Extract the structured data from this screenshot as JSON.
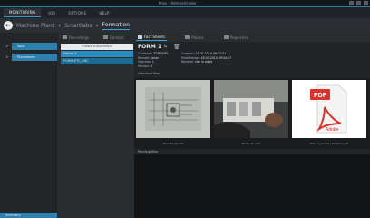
{
  "window": {
    "title": "Maxi - Administrador"
  },
  "menu": {
    "items": [
      {
        "label": "MONITORING",
        "active": true
      },
      {
        "label": "JOB",
        "active": false
      },
      {
        "label": "OPTIONS",
        "active": false
      },
      {
        "label": "HELP",
        "active": false
      }
    ]
  },
  "breadcrumb": {
    "items": [
      "Machine Plant",
      "Smartlabs",
      "Formation"
    ]
  },
  "sidebar": {
    "items": [
      {
        "label": "Tools"
      },
      {
        "label": "Procedures"
      }
    ],
    "bottom_label": "Inventory"
  },
  "midpanel": {
    "search_placeholder": "Create a document",
    "rows": [
      {
        "label": "Forme 1",
        "selected": true
      },
      {
        "label": "FORM_ETC_ARC",
        "selected": false
      }
    ]
  },
  "top_tabs": {
    "items": [
      "Recordings",
      "Contact"
    ]
  },
  "detail_tabs": {
    "items": [
      {
        "label": "Fact Sheets",
        "active": true
      },
      {
        "label": "Photos",
        "active": false
      },
      {
        "label": "Properties",
        "active": false
      }
    ]
  },
  "detail": {
    "title": "FORM 1",
    "meta_left": [
      {
        "k": "Customer:",
        "v": "TORNADE"
      },
      {
        "k": "Remote:",
        "v": "Johan"
      },
      {
        "k": "Operator:",
        "v": "L"
      },
      {
        "k": "Version:",
        "v": "4"
      }
    ],
    "meta_right": [
      {
        "k": "Creation:",
        "v": "21.02.2014 09:12:01"
      },
      {
        "k": "Modification:",
        "v": "16.03.2014 09:04:17"
      },
      {
        "k": "Revision:",
        "v": "Not in stock"
      }
    ],
    "files_label": "Attached files",
    "lower_label": "Pending files",
    "thumbs": [
      {
        "caption": "Nice Blueprints",
        "kind": "blueprint"
      },
      {
        "caption": "Photo de coût",
        "kind": "photo"
      },
      {
        "caption": "Mise à jour de l'antenne.pdf",
        "kind": "pdf"
      }
    ],
    "pdf_badge": "PDF",
    "adobe_label": "Adobe"
  },
  "colors": {
    "accent": "#2e7fae",
    "selected_row": "#2c8bc0",
    "pdf_red": "#d9342b"
  }
}
